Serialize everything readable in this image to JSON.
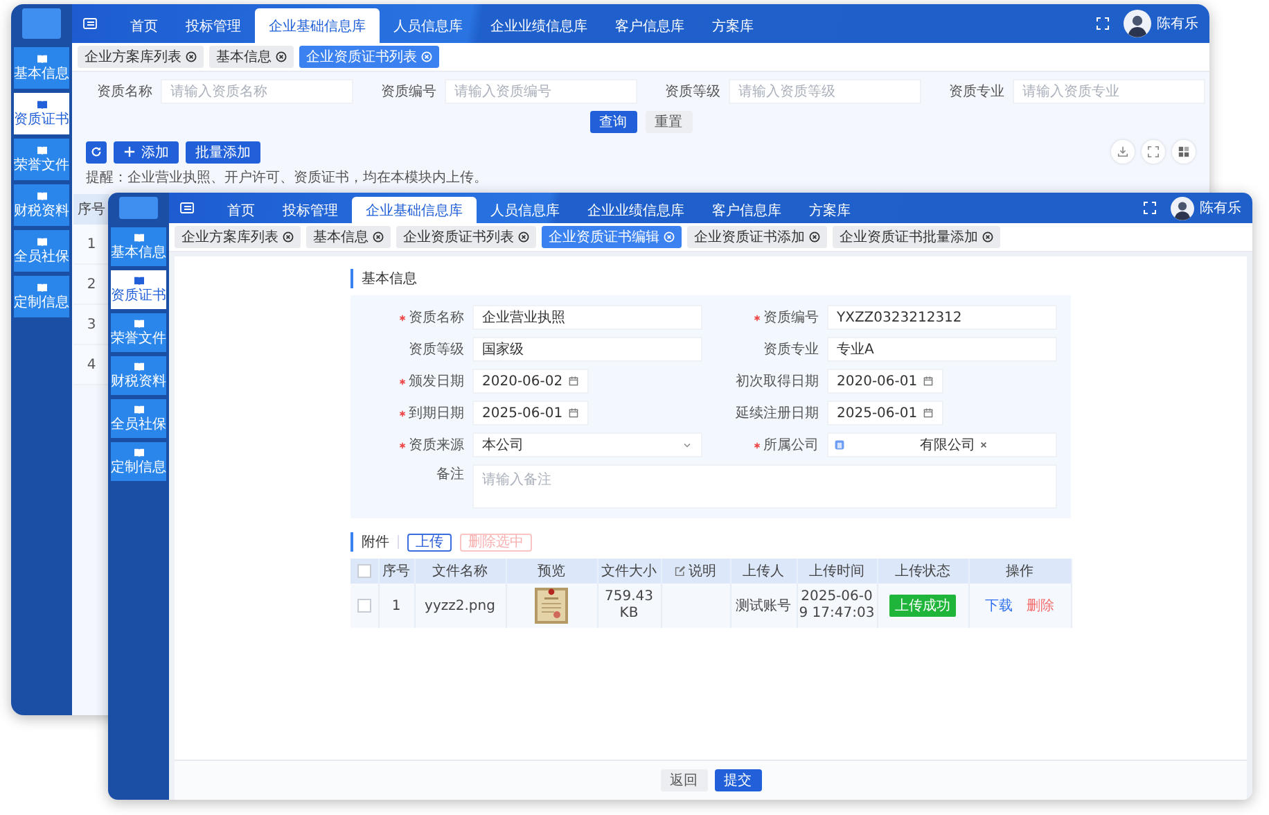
{
  "back_window": {
    "sidebar": {
      "items": [
        {
          "label": "基本信息",
          "selected": false
        },
        {
          "label": "资质证书",
          "selected": true
        },
        {
          "label": "荣誉文件",
          "selected": false
        },
        {
          "label": "财税资料",
          "selected": false
        },
        {
          "label": "全员社保",
          "selected": false
        },
        {
          "label": "定制信息",
          "selected": false
        }
      ]
    },
    "nav": {
      "items": [
        {
          "label": "首页",
          "selected": false
        },
        {
          "label": "投标管理",
          "selected": false
        },
        {
          "label": "企业基础信息库",
          "selected": true
        },
        {
          "label": "人员信息库",
          "selected": false
        },
        {
          "label": "企业业绩信息库",
          "selected": false
        },
        {
          "label": "客户信息库",
          "selected": false
        },
        {
          "label": "方案库",
          "selected": false
        }
      ]
    },
    "user": {
      "name": "陈有乐"
    },
    "tabs": [
      {
        "label": "企业方案库列表",
        "selected": false
      },
      {
        "label": "基本信息",
        "selected": false
      },
      {
        "label": "企业资质证书列表",
        "selected": true
      }
    ],
    "search_fields": [
      {
        "label": "资质名称",
        "placeholder": "请输入资质名称"
      },
      {
        "label": "资质编号",
        "placeholder": "请输入资质编号"
      },
      {
        "label": "资质等级",
        "placeholder": "请输入资质等级"
      },
      {
        "label": "资质专业",
        "placeholder": "请输入资质专业"
      }
    ],
    "search_buttons": [
      {
        "label": "查询",
        "kind": "primary"
      },
      {
        "label": "重置",
        "kind": "default"
      }
    ],
    "toolbar_buttons": [
      {
        "label": "添加",
        "kind": "add"
      },
      {
        "label": "批量添加",
        "kind": "primary"
      }
    ],
    "hint": "提醒：企业营业执照、开户许可、资质证书，均在本模块内上传。",
    "table": {
      "columns": [
        "序号"
      ],
      "rows": [
        {
          "index": "1"
        },
        {
          "index": "2"
        },
        {
          "index": "3"
        },
        {
          "index": "4"
        }
      ]
    }
  },
  "front_window": {
    "sidebar": {
      "items": [
        {
          "label": "基本信息",
          "selected": false
        },
        {
          "label": "资质证书",
          "selected": true
        },
        {
          "label": "荣誉文件",
          "selected": false
        },
        {
          "label": "财税资料",
          "selected": false
        },
        {
          "label": "全员社保",
          "selected": false
        },
        {
          "label": "定制信息",
          "selected": false
        }
      ]
    },
    "nav": {
      "items": [
        {
          "label": "首页",
          "selected": false
        },
        {
          "label": "投标管理",
          "selected": false
        },
        {
          "label": "企业基础信息库",
          "selected": true
        },
        {
          "label": "人员信息库",
          "selected": false
        },
        {
          "label": "企业业绩信息库",
          "selected": false
        },
        {
          "label": "客户信息库",
          "selected": false
        },
        {
          "label": "方案库",
          "selected": false
        }
      ]
    },
    "user": {
      "name": "陈有乐"
    },
    "tabs": [
      {
        "label": "企业方案库列表",
        "selected": false
      },
      {
        "label": "基本信息",
        "selected": false
      },
      {
        "label": "企业资质证书列表",
        "selected": false
      },
      {
        "label": "企业资质证书编辑",
        "selected": true
      },
      {
        "label": "企业资质证书添加",
        "selected": false
      },
      {
        "label": "企业资质证书批量添加",
        "selected": false
      }
    ],
    "form": {
      "title": "基本信息",
      "fields": [
        {
          "label": "资质名称",
          "required": true,
          "kind": "text",
          "value": "企业营业执照"
        },
        {
          "label": "资质编号",
          "required": true,
          "kind": "text",
          "value": "YXZZ0323212312"
        },
        {
          "label": "资质等级",
          "required": false,
          "kind": "text",
          "value": "国家级"
        },
        {
          "label": "资质专业",
          "required": false,
          "kind": "text",
          "value": "专业A"
        },
        {
          "label": "颁发日期",
          "required": true,
          "kind": "date",
          "value": "2020-06-02"
        },
        {
          "label": "初次取得日期",
          "required": false,
          "kind": "date",
          "value": "2020-06-01"
        },
        {
          "label": "到期日期",
          "required": true,
          "kind": "date",
          "value": "2025-06-01"
        },
        {
          "label": "延续注册日期",
          "required": false,
          "kind": "date",
          "value": "2025-06-01"
        },
        {
          "label": "资质来源",
          "required": true,
          "kind": "select",
          "value": "本公司"
        },
        {
          "label": "所属公司",
          "required": true,
          "kind": "tags",
          "tags": [
            "有限公司"
          ]
        },
        {
          "label": "备注",
          "required": false,
          "kind": "textarea",
          "placeholder": "请输入备注"
        }
      ]
    },
    "attachments": {
      "title": "附件",
      "buttons": [
        {
          "label": "上传",
          "kind": "primary",
          "disabled": false
        },
        {
          "label": "删除选中",
          "kind": "danger",
          "disabled": true
        }
      ],
      "select_all_checked": false,
      "columns": [
        {
          "label": "序号",
          "editable": false
        },
        {
          "label": "文件名称",
          "editable": false
        },
        {
          "label": "预览",
          "editable": false
        },
        {
          "label": "文件大小",
          "editable": false
        },
        {
          "label": "说明",
          "editable": true
        },
        {
          "label": "上传人",
          "editable": false
        },
        {
          "label": "上传时间",
          "editable": false
        },
        {
          "label": "上传状态",
          "editable": false
        },
        {
          "label": "操作",
          "editable": false
        }
      ],
      "rows": [
        {
          "checked": false,
          "index": "1",
          "file_name": "yyzz2.png",
          "preview": {
            "kind": "picture"
          },
          "size": "759.43 KB",
          "uploader": "测试账号",
          "time": "2025-06-09 17:47:03",
          "status": {
            "label": "上传成功",
            "kind": "success"
          },
          "actions": [
            {
              "label": "下载",
              "kind": "link"
            },
            {
              "label": "删除",
              "kind": "danger"
            }
          ]
        }
      ]
    },
    "footer_buttons": [
      {
        "label": "返回",
        "kind": "default"
      },
      {
        "label": "提交",
        "kind": "primary"
      }
    ]
  }
}
